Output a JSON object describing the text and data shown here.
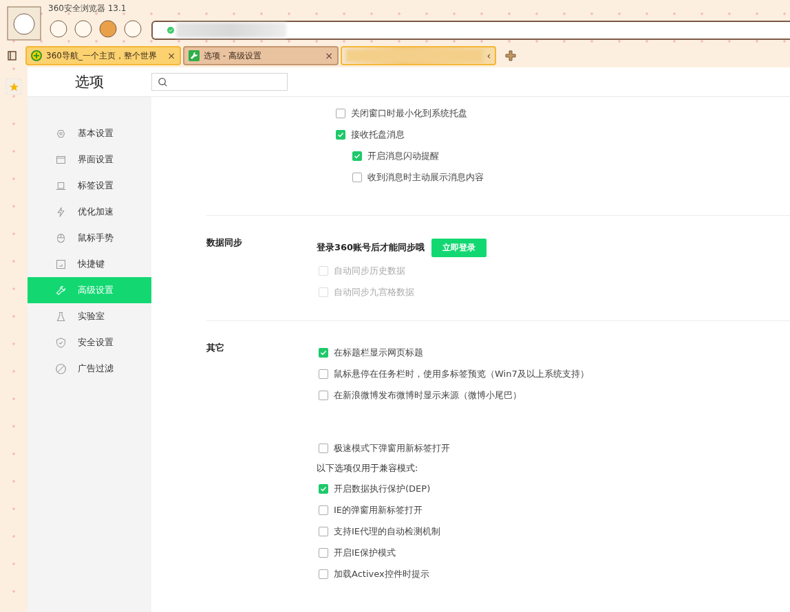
{
  "browser": {
    "title": "360安全浏览器 13.1"
  },
  "tabs": [
    {
      "label": "360导航_一个主页，整个世界",
      "close": "×",
      "selected": false,
      "kind": "nav"
    },
    {
      "label": "选项 - 高级设置",
      "close": "×",
      "selected": true,
      "kind": "settings"
    },
    {
      "kind": "blurred",
      "selected": false,
      "close": "‹"
    }
  ],
  "page": {
    "title": "选项"
  },
  "sidebar": {
    "items": [
      {
        "label": "基本设置",
        "selected": false
      },
      {
        "label": "界面设置",
        "selected": false
      },
      {
        "label": "标签设置",
        "selected": false
      },
      {
        "label": "优化加速",
        "selected": false
      },
      {
        "label": "鼠标手势",
        "selected": false
      },
      {
        "label": "快捷键",
        "selected": false
      },
      {
        "label": "高级设置",
        "selected": true
      },
      {
        "label": "实验室",
        "selected": false
      },
      {
        "label": "安全设置",
        "selected": false
      },
      {
        "label": "广告过滤",
        "selected": false
      }
    ]
  },
  "sections": [
    {
      "options": [
        {
          "kind": "checkbox",
          "label": "关闭窗口时最小化到系统托盘",
          "checked": false,
          "disabled": false
        },
        {
          "kind": "checkbox",
          "label": "接收托盘消息",
          "checked": true,
          "disabled": false,
          "children": [
            {
              "kind": "checkbox",
              "label": "开启消息闪动提醒",
              "checked": true,
              "disabled": false
            },
            {
              "kind": "checkbox",
              "label": "收到消息时主动展示消息内容",
              "checked": false,
              "disabled": false
            }
          ]
        }
      ]
    },
    {
      "heading": "数据同步",
      "options": [
        {
          "kind": "login",
          "label": "登录360账号后才能同步哦",
          "button": "立即登录"
        },
        {
          "kind": "checkbox",
          "label": "自动同步历史数据",
          "checked": false,
          "disabled": true
        },
        {
          "kind": "checkbox",
          "label": "自动同步九宫格数据",
          "checked": false,
          "disabled": true
        }
      ]
    },
    {
      "heading": "其它",
      "options": [
        {
          "kind": "checkbox",
          "label": "在标题栏显示网页标题",
          "checked": true,
          "disabled": false
        },
        {
          "kind": "checkbox",
          "label": "鼠标悬停在任务栏时，使用多标签预览（Win7及以上系统支持）",
          "checked": false,
          "disabled": false
        },
        {
          "kind": "checkbox",
          "label": "在新浪微博发布微博时显示来源（微博小尾巴）",
          "checked": false,
          "disabled": false
        },
        {
          "kind": "spacer"
        },
        {
          "kind": "checkbox",
          "label": "极速模式下弹窗用新标签打开",
          "checked": false,
          "disabled": false
        },
        {
          "kind": "note",
          "label": "以下选项仅用于兼容模式:"
        },
        {
          "kind": "checkbox",
          "label": "开启数据执行保护(DEP)",
          "checked": true,
          "disabled": false
        },
        {
          "kind": "checkbox",
          "label": "IE的弹窗用新标签打开",
          "checked": false,
          "disabled": false
        },
        {
          "kind": "checkbox",
          "label": "支持IE代理的自动检测机制",
          "checked": false,
          "disabled": false
        },
        {
          "kind": "checkbox",
          "label": "开启IE保护模式",
          "checked": false,
          "disabled": false
        },
        {
          "kind": "checkbox",
          "label": "加载Activex控件时提示",
          "checked": false,
          "disabled": false
        }
      ]
    }
  ]
}
